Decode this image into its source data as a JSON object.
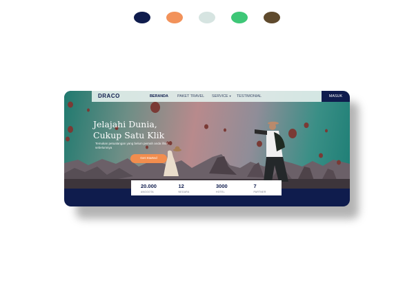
{
  "palette": [
    "#0f1c4d",
    "#f2925a",
    "#d6e4e1",
    "#3ec777",
    "#5f4a2d"
  ],
  "nav": {
    "logo": "DRACO",
    "items": [
      "BERANDA",
      "PAKET TRAVEL",
      "SERVICE",
      "TESTIMONIAL"
    ],
    "login": "MASUK"
  },
  "hero": {
    "title_line1": "Jelajahi Dunia,",
    "title_line2": "Cukup Satu Klik",
    "subtitle": "Temukan petualangan yang belum pernah anda lihat sebelumnya",
    "cta": "Get Started"
  },
  "stats": [
    {
      "value": "20.000",
      "label": "ANGGOTA"
    },
    {
      "value": "12",
      "label": "NEGARA"
    },
    {
      "value": "3000",
      "label": "HOTEL"
    },
    {
      "value": "7",
      "label": "PARTNER"
    }
  ]
}
